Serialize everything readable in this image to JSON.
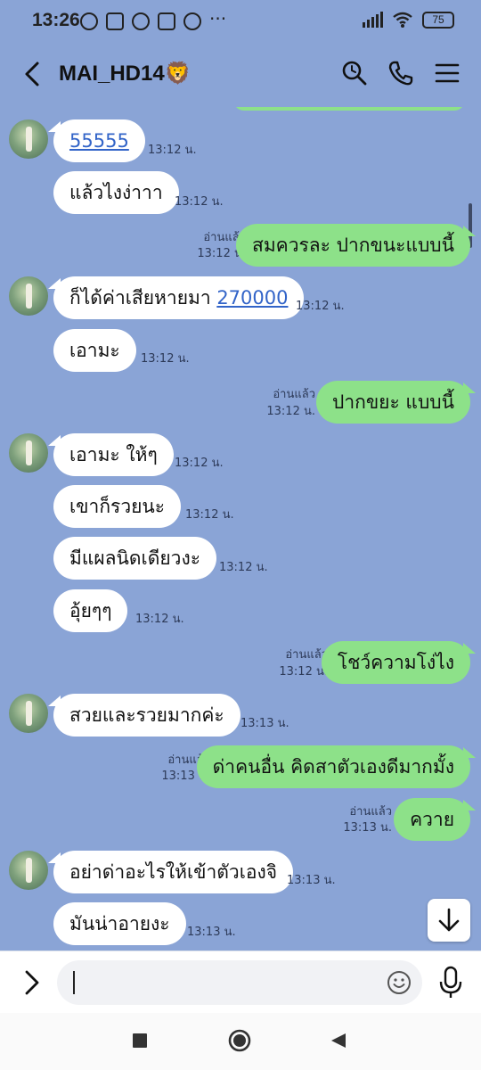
{
  "status_bar": {
    "time": "13:26",
    "battery": "75",
    "icons": [
      "alarm-icon",
      "headset-icon",
      "line-icon",
      "game-icon",
      "messenger-icon",
      "more-icon",
      "signal-icon",
      "wifi-icon",
      "battery-icon"
    ],
    "more": "···"
  },
  "header": {
    "title": "MAI_HD14🦁",
    "icons": [
      "back-icon",
      "search-icon",
      "phone-icon",
      "menu-icon"
    ]
  },
  "colors": {
    "chat_background": "#8aa4d6",
    "incoming_bubble": "#ffffff",
    "outgoing_bubble": "#8de189",
    "link": "#3264c8"
  },
  "messages": [
    {
      "side": "in",
      "text": "55555",
      "time": "13:12 น.",
      "avatar": true,
      "link": true
    },
    {
      "side": "in",
      "text": "แล้วไงง่าาา",
      "time": "13:12 น."
    },
    {
      "side": "out",
      "text": "สมควรละ ปากขนะแบบนี้",
      "read": "อ่านแล้ว",
      "time": "13:12 น."
    },
    {
      "side": "in",
      "text": "ก็ได้ค่าเสียหายมา ",
      "link_text": "270000",
      "time": "13:12 น.",
      "avatar": true
    },
    {
      "side": "in",
      "text": "เอามะ",
      "time": "13:12 น."
    },
    {
      "side": "out",
      "text": "ปากขยะ แบบนี้",
      "read": "อ่านแล้ว",
      "time": "13:12 น."
    },
    {
      "side": "in",
      "text": "เอามะ ให้ๆ",
      "time": "13:12 น.",
      "avatar": true
    },
    {
      "side": "in",
      "text": "เขาก็รวยนะ",
      "time": "13:12 น."
    },
    {
      "side": "in",
      "text": "มีแผลนิดเดียวงะ",
      "time": "13:12 น."
    },
    {
      "side": "in",
      "text": "อุ้ยๆๆ",
      "time": "13:12 น."
    },
    {
      "side": "out",
      "text": "โชว์ความโง่ไง",
      "read": "อ่านแล้ว",
      "time": "13:12 น."
    },
    {
      "side": "in",
      "text": "สวยและรวยมากค่ะ",
      "time": "13:13 น.",
      "avatar": true
    },
    {
      "side": "out",
      "text": "ด่าคนอื่น คิดสาตัวเองดีมากมั้ง",
      "read": "อ่านแล้ว",
      "time": "13:13 น."
    },
    {
      "side": "out",
      "text": "ควาย",
      "read": "อ่านแล้ว",
      "time": "13:13 น."
    },
    {
      "side": "in",
      "text": "อย่าด่าอะไรให้เข้าตัวเองจิ",
      "time": "13:13 น.",
      "avatar": true
    },
    {
      "side": "in",
      "text": "มันน่าอายงะ",
      "time": "13:13 น."
    }
  ],
  "input": {
    "placeholder": "",
    "icons": [
      "expand-icon",
      "emoji-icon",
      "mic-icon"
    ]
  },
  "navbar": {
    "icons": [
      "recents-icon",
      "home-icon",
      "back-nav-icon"
    ]
  }
}
